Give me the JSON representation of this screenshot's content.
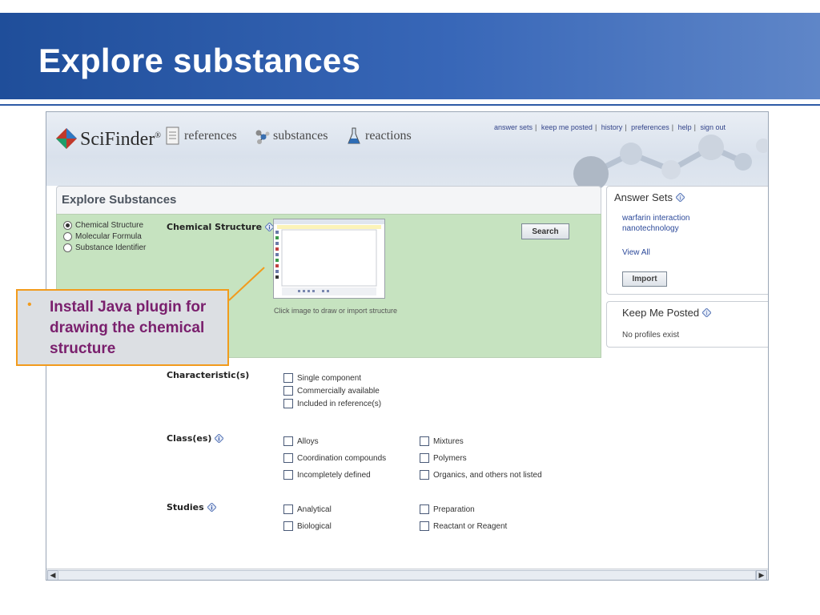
{
  "slide": {
    "title": "Explore substances"
  },
  "scifinder": {
    "brand": "SciFinder",
    "nav": {
      "references": "references",
      "substances": "substances",
      "reactions": "reactions"
    },
    "toplinks": [
      "answer sets",
      "keep me posted",
      "history",
      "preferences",
      "help",
      "sign out"
    ]
  },
  "explore": {
    "panel_title": "Explore Substances",
    "search_options": [
      "Chemical Structure",
      "Molecular Formula",
      "Substance Identifier"
    ],
    "selected_option": "Chemical Structure",
    "chemical_structure_label": "Chemical Structure",
    "caption": "Click image to draw or import structure",
    "search_button": "Search",
    "characteristics_label": "Characteristic(s)",
    "characteristics": [
      "Single component",
      "Commercially available",
      "Included in reference(s)"
    ],
    "classes_label": "Class(es)",
    "classes_col1": [
      "Alloys",
      "Coordination compounds",
      "Incompletely defined"
    ],
    "classes_col2": [
      "Mixtures",
      "Polymers",
      "Organics, and others not listed"
    ],
    "studies_label": "Studies",
    "studies_col1": [
      "Analytical",
      "Biological"
    ],
    "studies_col2": [
      "Preparation",
      "Reactant or Reagent"
    ]
  },
  "sidebar": {
    "answer_sets_title": "Answer Sets",
    "answer_sets": [
      "warfarin interaction",
      "nanotechnology"
    ],
    "view_all": "View All",
    "import_button": "Import",
    "keep_me_posted_title": "Keep Me Posted",
    "keep_me_posted_text": "No profiles exist"
  },
  "callout": {
    "text": "Install Java plugin for drawing the chemical structure"
  },
  "colors": {
    "title_band": "#2d5aa6",
    "panel_green": "#c6e3c0",
    "callout_border": "#f29b1c",
    "callout_text": "#7a1f6d"
  }
}
